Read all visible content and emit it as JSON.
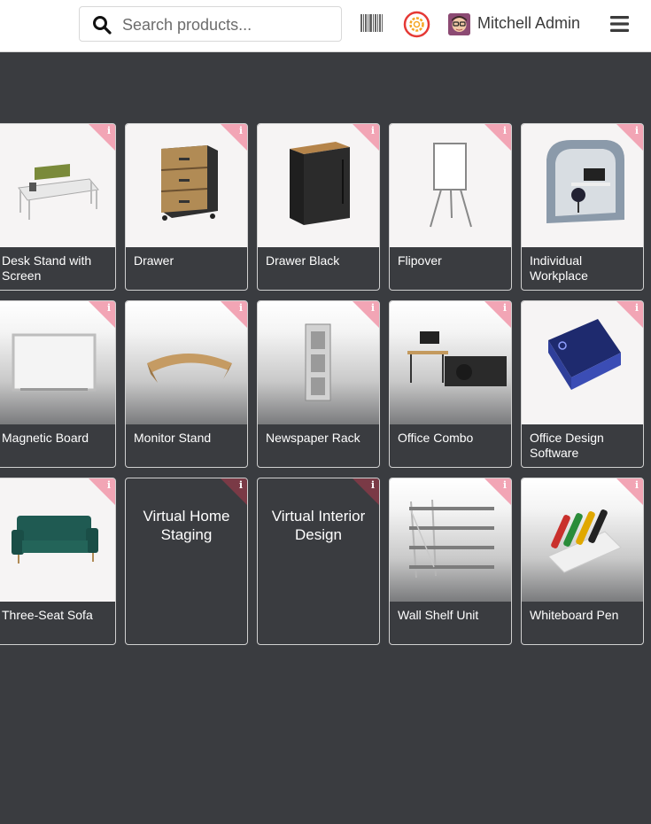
{
  "header": {
    "search_placeholder": "Search products...",
    "user_name": "Mitchell Admin",
    "icons": [
      "search-icon",
      "barcode-icon",
      "gear-icon",
      "avatar",
      "menu-icon"
    ]
  },
  "products": [
    {
      "name": "Desk Stand with Screen"
    },
    {
      "name": "Drawer"
    },
    {
      "name": "Drawer Black"
    },
    {
      "name": "Flipover"
    },
    {
      "name": "Individual Workplace"
    },
    {
      "name": "Magnetic Board"
    },
    {
      "name": "Monitor Stand"
    },
    {
      "name": "Newspaper Rack"
    },
    {
      "name": "Office Combo"
    },
    {
      "name": "Office Design Software"
    },
    {
      "name": "Three-Seat Sofa"
    },
    {
      "name": "Virtual Home Staging"
    },
    {
      "name": "Virtual Interior Design"
    },
    {
      "name": "Wall Shelf Unit"
    },
    {
      "name": "Whiteboard Pen"
    }
  ],
  "info_label": "i",
  "colors": {
    "background": "#3a3c40",
    "ribbon": "#f2a5b5",
    "ribbon_dark": "#7a3a46",
    "gear": "#e53935"
  }
}
